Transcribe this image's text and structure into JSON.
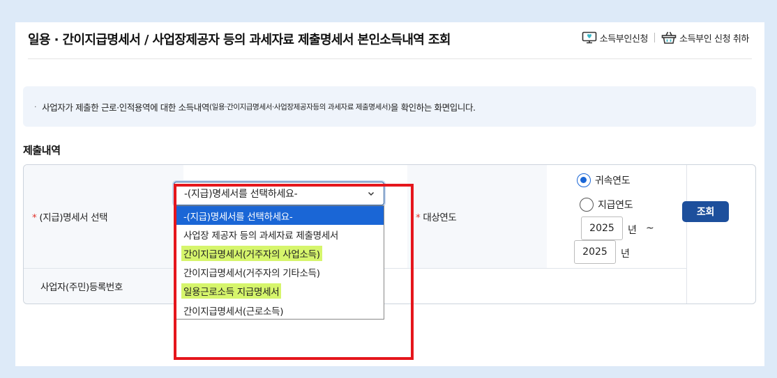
{
  "page": {
    "title": "일용 · 간이지급명세서 / 사업장제공자 등의 과세자료 제출명세서 본인소득내역 조회",
    "links": [
      {
        "label": "소득부인신청",
        "icon": "monitor-heart-icon"
      },
      {
        "label": "소득부인 신청 취하",
        "icon": "basket-icon"
      }
    ]
  },
  "notice": {
    "bullet": "·",
    "text_main": "사업자가 제출한 근로·인적용역에 대한 소득내역",
    "text_small": "(일용·간이지급명세서·사업장제공자등의 과세자료 제출명세서)",
    "text_end": "을 확인하는 화면입니다."
  },
  "section": {
    "title": "제출내역"
  },
  "form": {
    "required_mark": "*",
    "statement_label": "(지급)명세서 선택",
    "target_year_label": "대상연도",
    "business_no_label": "사업자(주민)등록번호",
    "select": {
      "value": "-(지급)명세서를 선택하세요-",
      "options": [
        {
          "label": "-(지급)명세서를 선택하세요-",
          "selected": true,
          "highlight": false
        },
        {
          "label": "사업장 제공자 등의 과세자료 제출명세서",
          "selected": false,
          "highlight": false
        },
        {
          "label": "간이지급명세서(거주자의 사업소득)",
          "selected": false,
          "highlight": true
        },
        {
          "label": "간이지급명세서(거주자의 기타소득)",
          "selected": false,
          "highlight": false
        },
        {
          "label": "일용근로소득 지급명세서",
          "selected": false,
          "highlight": true
        },
        {
          "label": "간이지급명세서(근로소득)",
          "selected": false,
          "highlight": false
        }
      ]
    },
    "year_basis": [
      {
        "label": "귀속연도",
        "checked": true
      },
      {
        "label": "지급연도",
        "checked": false
      }
    ],
    "year_from": "2025",
    "year_to": "2025",
    "year_unit": "년",
    "range_sep": "~",
    "search_label": "조회"
  },
  "colors": {
    "accent": "#1a66d6",
    "button": "#1d4f9c",
    "highlight": "#d6f56c",
    "annotation_frame": "#e5161c",
    "required": "#e0332b"
  }
}
